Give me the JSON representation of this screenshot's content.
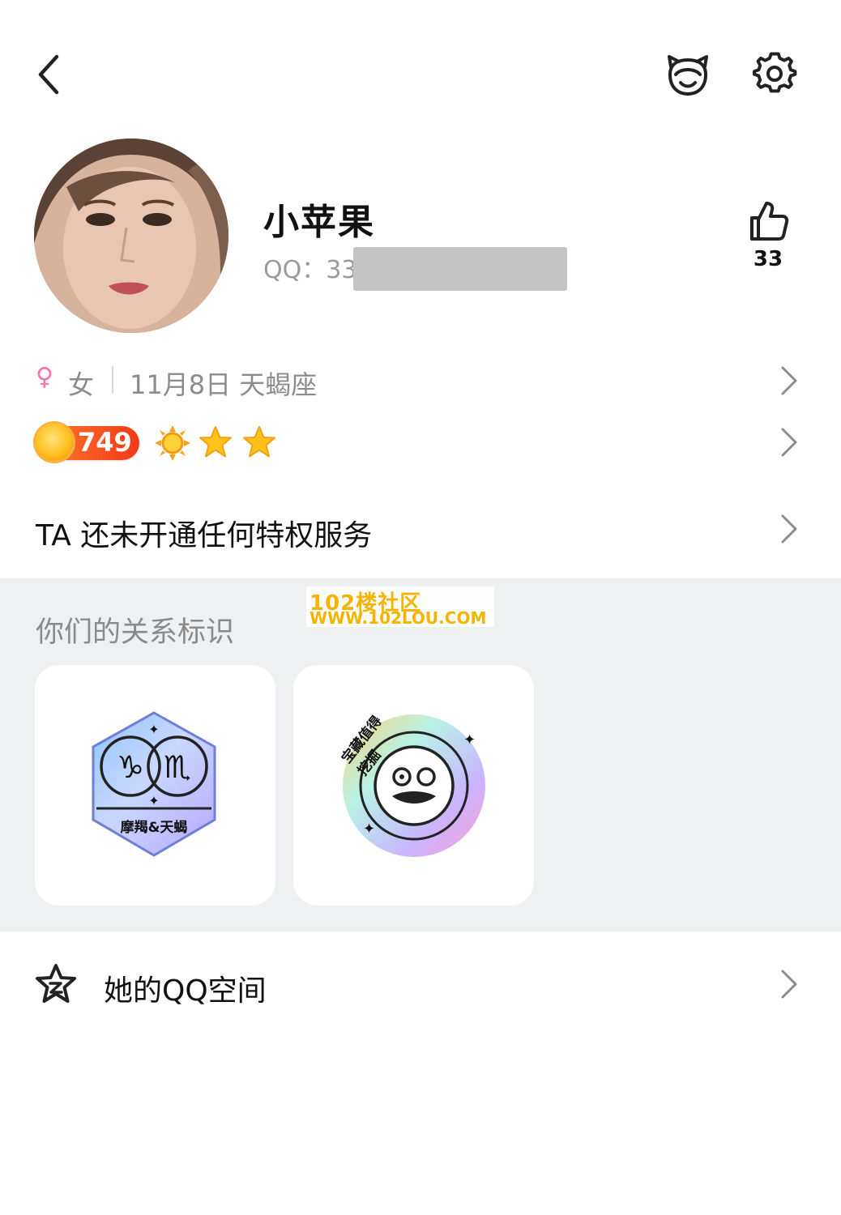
{
  "header": {
    "back_icon": "chevron-left-icon",
    "pet_icon": "pet-face-icon",
    "settings_icon": "gear-icon"
  },
  "profile": {
    "name": "小苹果",
    "qq_label": "QQ：33",
    "likes": "33",
    "like_icon": "thumb-up-icon"
  },
  "info": {
    "gender_symbol": "♀",
    "gender": "女",
    "birthday_sign": "11月8日 天蝎座"
  },
  "level": {
    "score": "749",
    "icons": [
      "sun-icon",
      "star-icon",
      "star-icon"
    ]
  },
  "privilege": {
    "text": "TA 还未开通任何特权服务"
  },
  "relationship": {
    "title": "你们的关系标识",
    "badges": [
      {
        "name": "zodiac-badge",
        "label": "摩羯&天蝎"
      },
      {
        "name": "treasure-badge",
        "label": "宝藏值得挖掘"
      }
    ]
  },
  "watermark": {
    "line1": "102楼社区",
    "line2": "WWW.102LOU.COM"
  },
  "qzone": {
    "label": "她的QQ空间",
    "icon": "star-outline-icon"
  },
  "colors": {
    "accent_female": "#ff6fa8",
    "level_pill": "#f23a1a",
    "section_bg": "#eff0f2",
    "watermark": "#f4b400"
  }
}
